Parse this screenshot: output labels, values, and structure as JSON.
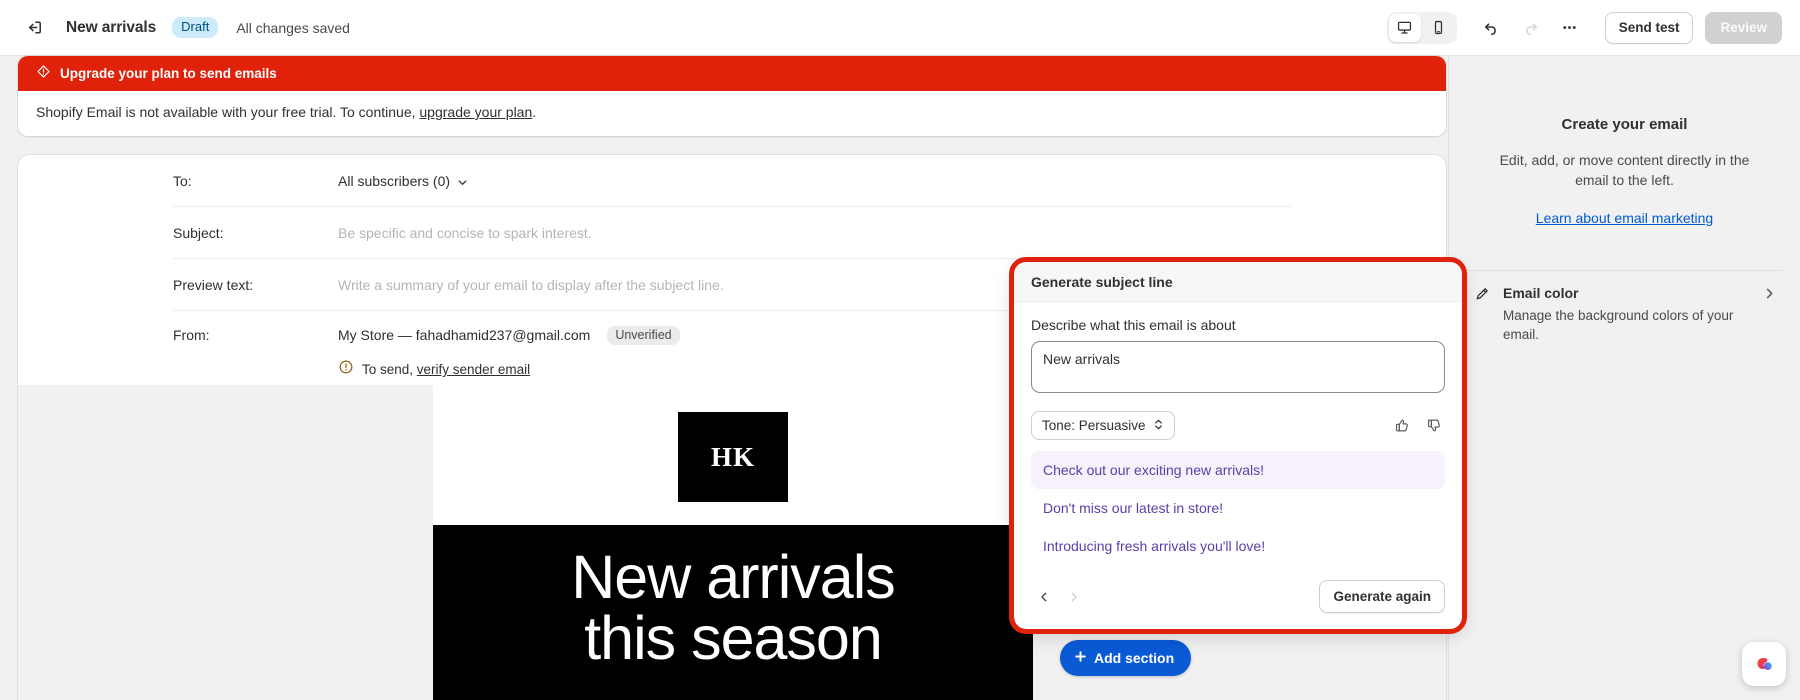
{
  "topbar": {
    "back_icon": "exit-icon",
    "title": "New arrivals",
    "status_badge": "Draft",
    "saved_text": "All changes saved",
    "desktop_icon": "desktop-icon",
    "mobile_icon": "mobile-icon",
    "undo_icon": "undo-icon",
    "redo_icon": "redo-icon",
    "more_icon": "ellipsis-icon",
    "send_test_label": "Send test",
    "review_label": "Review"
  },
  "banner": {
    "icon": "alert-diamond-icon",
    "heading": "Upgrade your plan to send emails",
    "body_before": "Shopify Email is not available with your free trial. To continue, ",
    "body_link": "upgrade your plan",
    "body_after": "."
  },
  "email_fields": {
    "to_label": "To:",
    "to_value": "All subscribers (0)",
    "subject_label": "Subject:",
    "subject_placeholder": "Be specific and concise to spark interest.",
    "preview_label": "Preview text:",
    "preview_placeholder": "Write a summary of your email to display after the subject line.",
    "from_label": "From:",
    "from_value": "My Store — fahadhamid237@gmail.com",
    "from_badge": "Unverified",
    "verify_prefix": "To send, ",
    "verify_link": "verify sender email",
    "sparkle_icon": "ai-sparkle-icon",
    "variable_icon": "variable-braces-icon"
  },
  "preview": {
    "logo_text": "HK",
    "hero_line1": "New arrivals",
    "hero_line2": "this season",
    "add_section_label": "Add section",
    "add_section_icon": "plus-icon"
  },
  "sidebar": {
    "title": "Create your email",
    "description": "Edit, add, or move content directly in the email to the left.",
    "link": "Learn about email marketing",
    "rows": [
      {
        "icon": "paint-brush-icon",
        "title": "Email color",
        "description": "Manage the background colors of your email.",
        "chevron": "chevron-right-icon"
      }
    ]
  },
  "popover": {
    "header": "Generate subject line",
    "field_label": "Describe what this email is about",
    "input_value": "New arrivals",
    "tone_label": "Tone: Persuasive",
    "tone_icon": "select-chevrons-icon",
    "thumbs_up_icon": "thumbs-up-icon",
    "thumbs_down_icon": "thumbs-down-icon",
    "suggestions": [
      "Check out our exciting new arrivals!",
      "Don't miss our latest in store!",
      "Introducing fresh arrivals you'll love!"
    ],
    "selected_index": 0,
    "prev_icon": "chevron-left-icon",
    "next_icon": "chevron-right-icon",
    "generate_again_label": "Generate again",
    "accent_color": "#e0220a",
    "suggestion_color": "#5c3ea8"
  },
  "help": {
    "icon": "help-assistant-icon"
  }
}
